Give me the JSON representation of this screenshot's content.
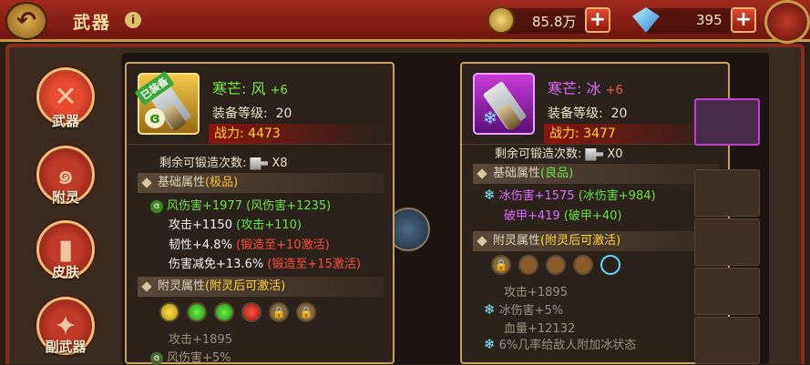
{
  "header": {
    "back_icon": "back-arrow-icon",
    "title": "武器",
    "info_icon": "i",
    "gold": "85.8万",
    "gems": "395",
    "plus": "+"
  },
  "nav": [
    {
      "label": "武器",
      "icon": "crossed-swords-icon",
      "selected": true
    },
    {
      "label": "附灵",
      "icon": "spirit-swirl-icon",
      "selected": false
    },
    {
      "label": "皮肤",
      "icon": "scroll-icon",
      "selected": false
    },
    {
      "label": "副武器",
      "icon": "shuriken-icon",
      "selected": false
    }
  ],
  "left": {
    "badge": "已装备",
    "name": "寒芒: 风",
    "plus": "+6",
    "level_label": "装备等级:",
    "level": "20",
    "power_label": "战力:",
    "power": "4473",
    "forge_label": "剩余可锻造次数:",
    "forge_count": "X8",
    "base_header": "基础属性",
    "base_quality": "(极品)",
    "stats": [
      {
        "icon": "wind",
        "text": "风伤害+1977",
        "extra": "(风伤害+1235)",
        "extra_color": "#6ce04a",
        "color": "#6ce04a"
      },
      {
        "icon": "",
        "text": "攻击+1150",
        "extra": "(攻击+110)",
        "extra_color": "#6ce04a",
        "color": "#f0f0f0"
      },
      {
        "icon": "",
        "text": "韧性+4.8%",
        "extra": "(锻造至+10激活)",
        "extra_color": "#ff4a3a",
        "color": "#f0f0f0"
      },
      {
        "icon": "",
        "text": "伤害减免+13.6%",
        "extra": "(锻造至+15激活)",
        "extra_color": "#ff4a3a",
        "color": "#f0f0f0"
      }
    ],
    "spirit_header": "附灵属性",
    "spirit_note": "(附灵后可激活)",
    "gems_row": [
      "yellow",
      "green",
      "green",
      "red",
      "lock",
      "lock"
    ],
    "spirit_stats": [
      "攻击+1895",
      "风伤害+5%"
    ]
  },
  "right": {
    "name": "寒芒: 冰",
    "plus": "+6",
    "level_label": "装备等级:",
    "level": "20",
    "power_label": "战力:",
    "power": "3477",
    "forge_label": "剩余可锻造次数:",
    "forge_count": "X0",
    "base_header": "基础属性",
    "base_quality": "(良品)",
    "stats": [
      {
        "text": "冰伤害+1575",
        "extra": "(冰伤害+984)"
      },
      {
        "text": "破甲+419",
        "extra": "(破甲+40)"
      }
    ],
    "spirit_header": "附灵属性",
    "spirit_note": "(附灵后可激活)",
    "gems_row": [
      "lock",
      "brown",
      "brown",
      "brown",
      "empty-selected"
    ],
    "spirit_stats": [
      {
        "icon": "",
        "text": "攻击+1895"
      },
      {
        "icon": "ice",
        "text": "冰伤害+5%"
      },
      {
        "icon": "",
        "text": "血量+12132"
      },
      {
        "icon": "ice",
        "text": "6%几率给敌人附加冰状态"
      }
    ]
  },
  "colors": {
    "wind_green": "#7ce84a",
    "ice_purple": "#e06aff",
    "plus_red": "#ff5a4a",
    "power_text": "#ffd23a",
    "quality_gold": "#ffc23a",
    "quality_green": "#6ce04a",
    "note_gold": "#ffd23a"
  }
}
